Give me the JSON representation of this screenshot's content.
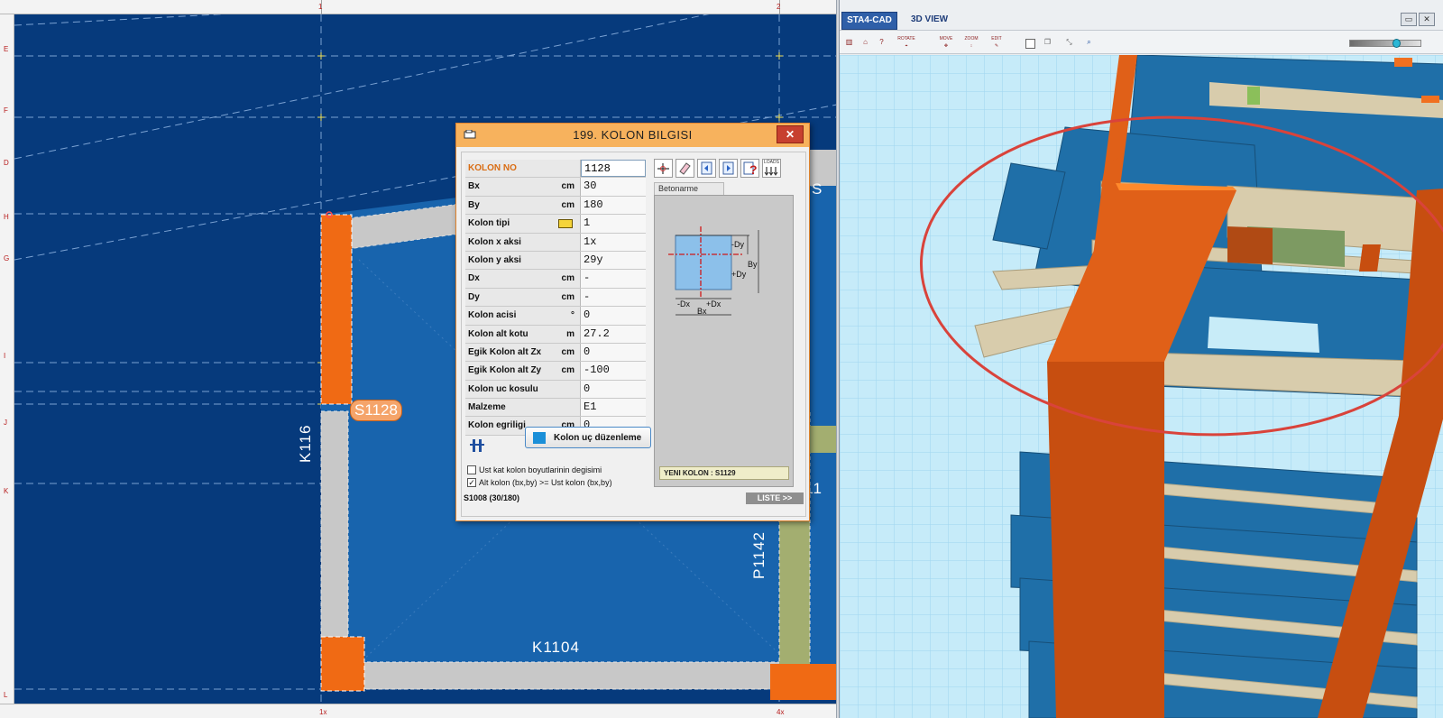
{
  "cad": {
    "ruler_top_marks": [
      "1",
      "2"
    ],
    "ruler_left_marks": [
      "E",
      "F",
      "D",
      "H",
      "G",
      "I",
      "J",
      "K",
      "L"
    ],
    "ruler_bottom_marks": [
      "1x",
      "4x"
    ],
    "labels": {
      "column_tag": "S1128",
      "beam_left": "K116",
      "beam_bottom": "K1104",
      "beam_right": "P1142",
      "partial_right_1": "S",
      "partial_right_2": "S11"
    }
  },
  "dialog": {
    "title": "199.  KOLON  BILGISI",
    "close_label": "✕",
    "fields": [
      {
        "label": "KOLON NO",
        "unit": "",
        "value": "1128"
      },
      {
        "label": "Bx",
        "unit": "cm",
        "value": "30"
      },
      {
        "label": "By",
        "unit": "cm",
        "value": "180"
      },
      {
        "label": "Kolon tipi",
        "unit": "",
        "value": "1"
      },
      {
        "label": "Kolon x aksi",
        "unit": "",
        "value": "1x"
      },
      {
        "label": "Kolon y aksi",
        "unit": "",
        "value": "29y"
      },
      {
        "label": "Dx",
        "unit": "cm",
        "value": "-"
      },
      {
        "label": "Dy",
        "unit": "cm",
        "value": "-"
      },
      {
        "label": "Kolon acisi",
        "unit": "°",
        "value": "0"
      },
      {
        "label": "Kolon alt kotu",
        "unit": "m",
        "value": "27.2"
      },
      {
        "label": "Egik Kolon alt Zx",
        "unit": "cm",
        "value": "0"
      },
      {
        "label": "Egik Kolon alt Zy",
        "unit": "cm",
        "value": "-100"
      },
      {
        "label": "Kolon uc kosulu",
        "unit": "",
        "value": "0"
      },
      {
        "label": "Malzeme",
        "unit": "",
        "value": "E1"
      },
      {
        "label": "Kolon egriligi",
        "unit": "cm",
        "value": "0"
      }
    ],
    "tab_label": "Betonarme",
    "diagram": {
      "neg_dy": "-Dy",
      "pos_dy": "+Dy",
      "by": "By",
      "neg_dx": "-Dx",
      "pos_dx": "+Dx",
      "bx": "Bx"
    },
    "new_column_label": "YENI KOLON : S1129",
    "edit_button_label": "Kolon uç düzenleme",
    "check1_label": "Ust kat kolon boyutlarinin  degisimi",
    "check2_label": "Alt kolon (bx,by) >= Ust kolon (bx,by)",
    "check2_mark": "✓",
    "status_text": "S1008 (30/180)",
    "liste_label": "LISTE >>",
    "tool_icons": [
      "axis-icon",
      "eraser-icon",
      "prev-icon",
      "next-icon",
      "help-icon",
      "loads-icon"
    ],
    "loads_text": "LOADS"
  },
  "view3d": {
    "brand": "STA4-CAD",
    "title": "3D VIEW",
    "tool_captions": [
      "ROTATE",
      "MOVE",
      "ZOOM",
      "EDIT"
    ],
    "colors": {
      "column_orange": "#e06018",
      "slab_blue": "#1f6fa8",
      "beam_beige": "#d8ccac",
      "ground_cyan": "#bfe6f7",
      "annotation_red": "#d9433b"
    }
  }
}
